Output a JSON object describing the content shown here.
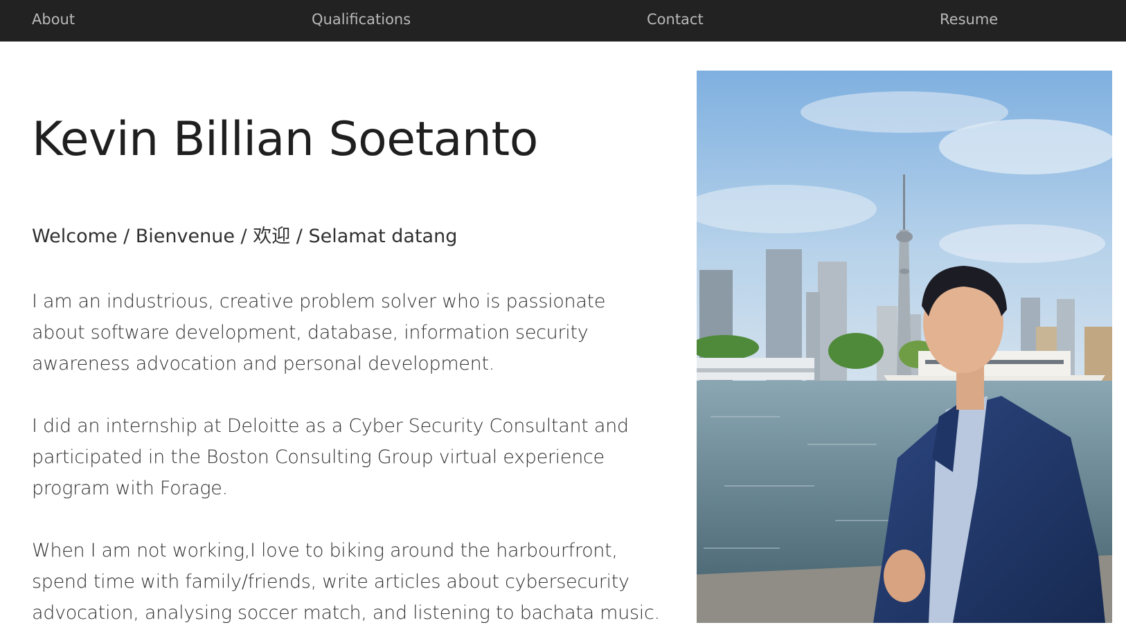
{
  "nav": {
    "about": "About",
    "qualifications": "Qualifications",
    "contact": "Contact",
    "resume": "Resume"
  },
  "hero": {
    "name": "Kevin Billian Soetanto",
    "welcome": "Welcome / Bienvenue / 欢迎 / Selamat datang",
    "paragraphs": [
      "I am an industrious, creative problem solver who is passionate about software development, database, information security awareness advocation and personal development.",
      "I did an internship at Deloitte as a Cyber Security Consultant and participated in the Boston Consulting Group virtual experience program with Forage.",
      "When I am not working,I love to biking around the harbourfront, spend time with family/friends, write articles about cybersecurity advocation, analysing soccer match, and listening to bachata music."
    ]
  },
  "colors": {
    "navbar_bg": "#222222",
    "nav_text": "#b9b9b9",
    "body_text": "#2f2f2f",
    "sky": "#8fb9e0",
    "water": "#6f8e9c",
    "suit": "#243a6a"
  }
}
